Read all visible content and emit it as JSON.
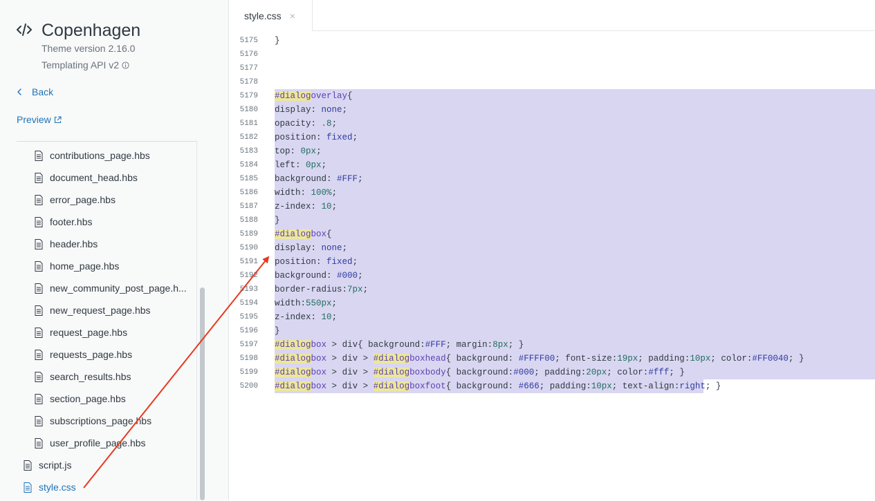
{
  "theme": {
    "name": "Copenhagen",
    "version": "Theme version 2.16.0",
    "api": "Templating API v2"
  },
  "nav": {
    "back": "Back",
    "preview": "Preview"
  },
  "files": [
    {
      "label": "contributions_page.hbs",
      "active": false,
      "indent": 1
    },
    {
      "label": "document_head.hbs",
      "active": false,
      "indent": 1
    },
    {
      "label": "error_page.hbs",
      "active": false,
      "indent": 1
    },
    {
      "label": "footer.hbs",
      "active": false,
      "indent": 1
    },
    {
      "label": "header.hbs",
      "active": false,
      "indent": 1
    },
    {
      "label": "home_page.hbs",
      "active": false,
      "indent": 1
    },
    {
      "label": "new_community_post_page.h...",
      "active": false,
      "indent": 1
    },
    {
      "label": "new_request_page.hbs",
      "active": false,
      "indent": 1
    },
    {
      "label": "request_page.hbs",
      "active": false,
      "indent": 1
    },
    {
      "label": "requests_page.hbs",
      "active": false,
      "indent": 1
    },
    {
      "label": "search_results.hbs",
      "active": false,
      "indent": 1
    },
    {
      "label": "section_page.hbs",
      "active": false,
      "indent": 1
    },
    {
      "label": "subscriptions_page.hbs",
      "active": false,
      "indent": 1
    },
    {
      "label": "user_profile_page.hbs",
      "active": false,
      "indent": 1
    },
    {
      "label": "script.js",
      "active": false,
      "indent": 0
    },
    {
      "label": "style.css",
      "active": true,
      "indent": 0
    }
  ],
  "tab": {
    "label": "style.css",
    "close": "×"
  },
  "code": [
    {
      "num": "5175",
      "text": "}",
      "sel": false
    },
    {
      "num": "5176",
      "text": "",
      "sel": false
    },
    {
      "num": "5177",
      "text": "",
      "sel": false
    },
    {
      "num": "5178",
      "text": "",
      "sel": false
    },
    {
      "num": "5179",
      "text": "#dialogoverlay{",
      "sel": true
    },
    {
      "num": "5180",
      "text": "display: none;",
      "sel": true
    },
    {
      "num": "5181",
      "text": "opacity: .8;",
      "sel": true
    },
    {
      "num": "5182",
      "text": "position: fixed;",
      "sel": true
    },
    {
      "num": "5183",
      "text": "top: 0px;",
      "sel": true
    },
    {
      "num": "5184",
      "text": "left: 0px;",
      "sel": true
    },
    {
      "num": "5185",
      "text": "background: #FFF;",
      "sel": true
    },
    {
      "num": "5186",
      "text": "width: 100%;",
      "sel": true
    },
    {
      "num": "5187",
      "text": "z-index: 10;",
      "sel": true
    },
    {
      "num": "5188",
      "text": "}",
      "sel": true
    },
    {
      "num": "5189",
      "text": "#dialogbox{",
      "sel": true
    },
    {
      "num": "5190",
      "text": "display: none;",
      "sel": true
    },
    {
      "num": "5191",
      "text": "position: fixed;",
      "sel": true
    },
    {
      "num": "5192",
      "text": "background: #000;",
      "sel": true
    },
    {
      "num": "5193",
      "text": "border-radius:7px;",
      "sel": true
    },
    {
      "num": "5194",
      "text": "width:550px;",
      "sel": true
    },
    {
      "num": "5195",
      "text": "z-index: 10;",
      "sel": true
    },
    {
      "num": "5196",
      "text": "}",
      "sel": true
    },
    {
      "num": "5197",
      "text": "#dialogbox > div{ background:#FFF; margin:8px; }",
      "sel": true
    },
    {
      "num": "5198",
      "text": "#dialogbox > div > #dialogboxhead{ background: #FFFF00; font-size:19px; padding:10px; color:#FF0040; }",
      "sel": true
    },
    {
      "num": "5199",
      "text": "#dialogbox > div > #dialogboxbody{ background:#000; padding:20px; color:#fff; }",
      "sel": true
    },
    {
      "num": "5200",
      "text": "#dialogbox > div > #dialogboxfoot{ background: #666; padding:10px; text-align:right; }",
      "sel": "partial"
    }
  ],
  "colors": {
    "link": "#1f73b7",
    "selection": "#d9d6f2",
    "search_highlight": "#ece79a",
    "arrow": "#e8391d"
  },
  "search_term": "dialog"
}
